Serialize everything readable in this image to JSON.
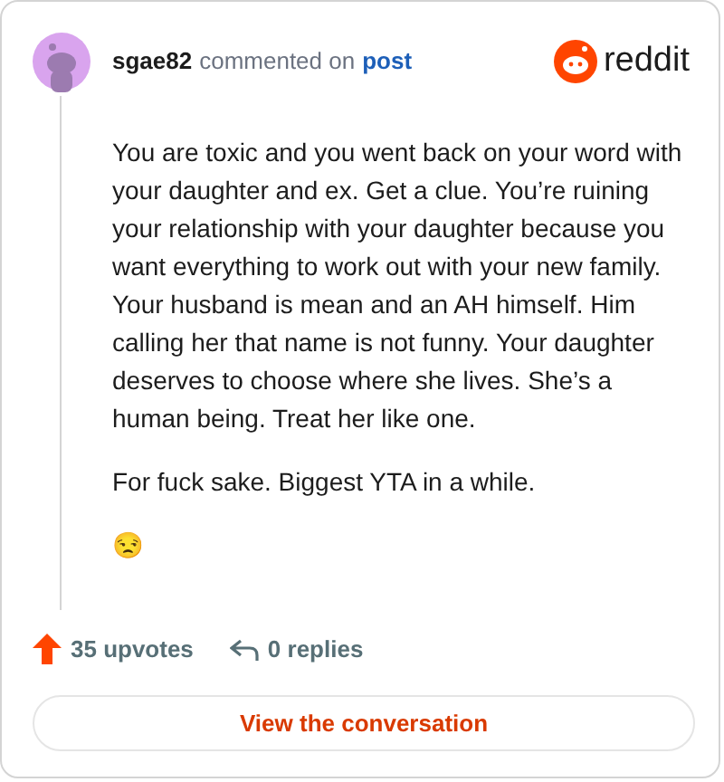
{
  "header": {
    "username": "sgae82",
    "action": "commented on",
    "link": "post",
    "brand": "reddit"
  },
  "comment": {
    "paragraphs": [
      "You are toxic and you went back on your word with your daughter and ex. Get a clue. You’re ruining your relationship with your daughter because you want everything to work out with your new family. Your husband is mean and an AH himself. Him calling her that name is not funny. Your daughter deserves to choose where she lives. She’s a human being. Treat her like one.",
      "For fuck sake. Biggest YTA in a while.",
      "😒"
    ]
  },
  "footer": {
    "upvotes": "35 upvotes",
    "replies": "0 replies"
  },
  "button": "View the conversation"
}
